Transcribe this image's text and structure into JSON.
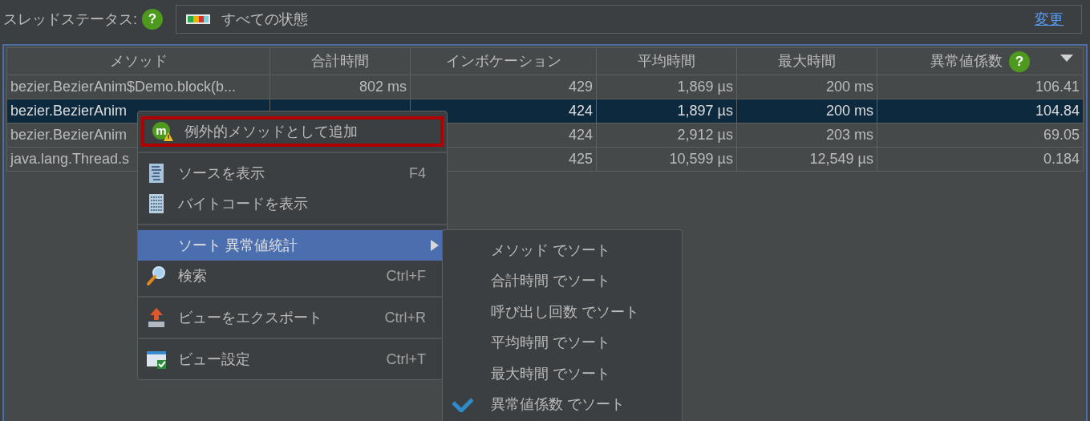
{
  "filter": {
    "label": "スレッドステータス:",
    "help": "?",
    "value": "すべての状態",
    "link": "変更"
  },
  "table": {
    "columns": [
      {
        "label": "メソッド",
        "sorted": false
      },
      {
        "label": "合計時間",
        "sorted": false
      },
      {
        "label": "インボケーション",
        "sorted": false
      },
      {
        "label": "平均時間",
        "sorted": false
      },
      {
        "label": "最大時間",
        "sorted": false
      },
      {
        "label": "異常値係数",
        "help": "?",
        "sorted": true
      }
    ],
    "rows": [
      {
        "selected": false,
        "cells": [
          "bezier.BezierAnim$Demo.block(b...",
          "802 ms",
          "429",
          "1,869 µs",
          "200 ms",
          "106.41"
        ]
      },
      {
        "selected": true,
        "cells": [
          "bezier.BezierAnim",
          null,
          "424",
          "1,897 µs",
          "200 ms",
          "104.84"
        ]
      },
      {
        "selected": false,
        "cells": [
          "bezier.BezierAnim",
          null,
          "424",
          "2,912 µs",
          "203 ms",
          "69.05"
        ]
      },
      {
        "selected": false,
        "cells": [
          "java.lang.Thread.s",
          null,
          "425",
          "10,599 µs",
          "12,549 µs",
          "0.184"
        ]
      }
    ]
  },
  "context_menu": [
    {
      "kind": "item",
      "badge": "m",
      "label": "例外的メソッドとして追加",
      "outlined": true,
      "highlighted": false
    },
    {
      "kind": "separator"
    },
    {
      "kind": "item",
      "label": "ソースを表示",
      "shortcut": "F4",
      "outlined": false,
      "highlighted": false
    },
    {
      "kind": "item",
      "label": "バイトコードを表示",
      "outlined": false,
      "highlighted": false
    },
    {
      "kind": "separator"
    },
    {
      "kind": "submenu",
      "label": "ソート 異常値統計",
      "outlined": false,
      "highlighted": true
    },
    {
      "kind": "item",
      "label": "検索",
      "shortcut": "Ctrl+F",
      "outlined": false,
      "highlighted": false
    },
    {
      "kind": "separator"
    },
    {
      "kind": "item",
      "label": "ビューをエクスポート",
      "shortcut": "Ctrl+R",
      "outlined": false,
      "highlighted": false
    },
    {
      "kind": "separator"
    },
    {
      "kind": "item",
      "label": "ビュー設定",
      "shortcut": "Ctrl+T",
      "outlined": false,
      "highlighted": false
    }
  ],
  "submenu": [
    {
      "label": "メソッド でソート",
      "checked": false
    },
    {
      "label": "合計時間 でソート",
      "checked": false
    },
    {
      "label": "呼び出し回数 でソート",
      "checked": false
    },
    {
      "label": "平均時間 でソート",
      "checked": false
    },
    {
      "label": "最大時間 でソート",
      "checked": false
    },
    {
      "label": "異常値係数 でソート",
      "checked": true
    }
  ]
}
